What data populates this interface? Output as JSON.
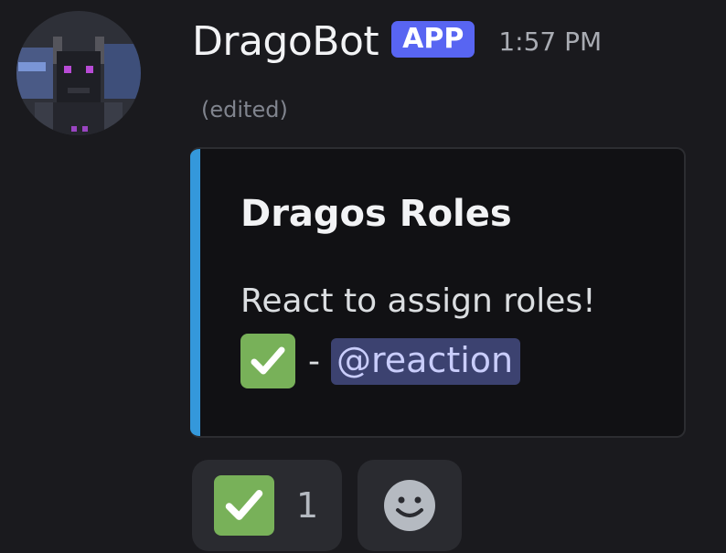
{
  "message": {
    "author": "DragoBot",
    "badge": "APP",
    "timestamp": "1:57 PM",
    "edited_label": "(edited)",
    "avatar_icon": "bot-avatar-icon"
  },
  "embed": {
    "accent_color": "#3498db",
    "title": "Dragos Roles",
    "description": "React to assign roles!",
    "role_emoji": "white-check-mark-emoji",
    "separator": "-",
    "role_mention": "@reaction"
  },
  "reactions": [
    {
      "emoji": "white-check-mark-emoji",
      "count": "1"
    }
  ],
  "add_reaction_icon": "add-reaction-smiley-icon",
  "colors": {
    "brand": "#5865f2",
    "background": "#1a1a1e",
    "check_emoji": "#78b159",
    "mention_bg": "#3c4270"
  }
}
